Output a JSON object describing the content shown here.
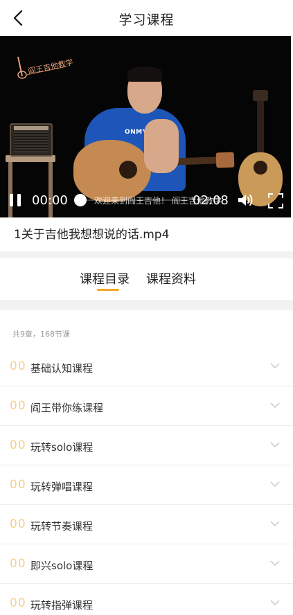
{
  "header": {
    "title": "学习课程",
    "back_icon": "chevron-left-icon"
  },
  "video": {
    "logo_text": "阎王吉他教学",
    "shirt_text": "ONMYGAME",
    "current_time": "00:00",
    "total_time": "02:08",
    "progress": 0,
    "marquee_text": "欢迎来到阎王吉他！ 阎王吉他教学",
    "icons": {
      "pause": "pause-icon",
      "volume": "volume-icon",
      "fullscreen": "fullscreen-icon"
    }
  },
  "file_title": "1关于吉他我想想说的话.mp4",
  "tabs": [
    {
      "label": "课程目录",
      "active": true
    },
    {
      "label": "课程资料",
      "active": false
    }
  ],
  "course_list": {
    "summary": "共9章，168节课",
    "chapters": [
      {
        "num": "00",
        "label": "基础认知课程"
      },
      {
        "num": "00",
        "label": "阎王带你练课程"
      },
      {
        "num": "00",
        "label": "玩转solo课程"
      },
      {
        "num": "00",
        "label": "玩转弹唱课程"
      },
      {
        "num": "00",
        "label": "玩转节奏课程"
      },
      {
        "num": "00",
        "label": "即兴solo课程"
      },
      {
        "num": "00",
        "label": "玩转指弹课程"
      }
    ]
  },
  "colors": {
    "accent": "#f5a623",
    "chapter_number": "#f7cf90",
    "muted_text": "#999999",
    "divider": "#f2f2f2"
  }
}
